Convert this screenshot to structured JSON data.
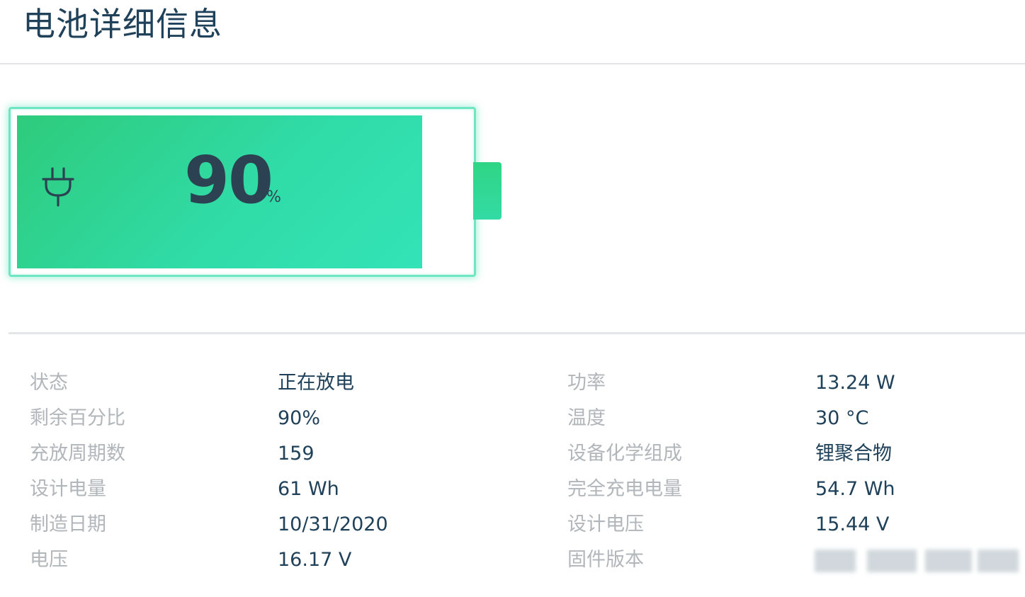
{
  "page": {
    "title": "电池详细信息"
  },
  "battery": {
    "level_fraction": 0.9,
    "percent": "90",
    "percent_sign": "%",
    "charging_icon": "plug-icon",
    "colors": {
      "fill_start": "#2ecb7b",
      "fill_end": "#33e3b7",
      "outline": "#6ee6c1",
      "text": "#2c4252"
    }
  },
  "details": {
    "left": [
      {
        "label": "状态",
        "value": "正在放电"
      },
      {
        "label": "剩余百分比",
        "value": "90%"
      },
      {
        "label": "充放周期数",
        "value": "159"
      },
      {
        "label": "设计电量",
        "value": "61 Wh"
      },
      {
        "label": "制造日期",
        "value": "10/31/2020"
      },
      {
        "label": "电压",
        "value": "16.17 V"
      }
    ],
    "right": [
      {
        "label": "功率",
        "value": "13.24 W"
      },
      {
        "label": "温度",
        "value": "30 °C"
      },
      {
        "label": "设备化学组成",
        "value": "锂聚合物"
      },
      {
        "label": "完全充电电量",
        "value": "54.7 Wh"
      },
      {
        "label": "设计电压",
        "value": "15.44 V"
      },
      {
        "label": "固件版本",
        "value": ""
      }
    ]
  },
  "colors": {
    "title": "#1f4159",
    "label": "#b1b6ba",
    "value": "#1f4159",
    "divider": "#e3e5e8"
  }
}
